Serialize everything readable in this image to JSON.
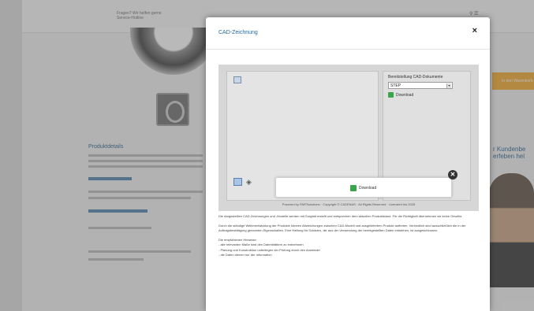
{
  "modal": {
    "title": "CAD-Zeichnung",
    "close": "×"
  },
  "viewer": {
    "panel_title": "Bereitstellung CAD-Dokumente",
    "format_value": "STEP",
    "format_arrow": "▾",
    "download_label": "Download",
    "footer": "Powered by PARTsolutions · Copyright © CADENAS · All Rights Reserved · Lizenziert bis 2025"
  },
  "popup": {
    "download_label": "Download",
    "close": "✕"
  },
  "body": {
    "p1": "Die dargestellten CAD-Zeichnungen und -Modelle werden mit Sorgfalt erstellt und entsprechen dem aktuellen Produktstand. Für die Richtigkeit übernehmen wir keine Gewähr.",
    "p2": "Durch die ständige Weiterentwicklung der Produkte können Abweichungen zwischen CAD-Modell und ausgeliefertem Produkt auftreten. Verbindlich sind ausschließlich die in der Auftragsbestätigung genannten Eigenschaften. Eine Haftung für Schäden, die aus der Verwendung der bereitgestellten Daten entstehen, ist ausgeschlossen.",
    "p3": "Die empfohlenen Hinweise:",
    "l1": "- alle relevanten Maße sind den Datenblättern zu entnehmen",
    "l2": "- Planung und Konstruktion unterliegen der Prüfung durch den Anwender",
    "l3": "- die Daten dienen nur der Information"
  },
  "background": {
    "header_note_1": "Fragen? Wir helfen gerne",
    "header_note_2": "Service-Hotline",
    "desc_title": "Produktdetails",
    "cart_label": "In den Warenkorb",
    "side_text_1": "r Kundenbe",
    "side_text_2": "erfeben hel"
  }
}
